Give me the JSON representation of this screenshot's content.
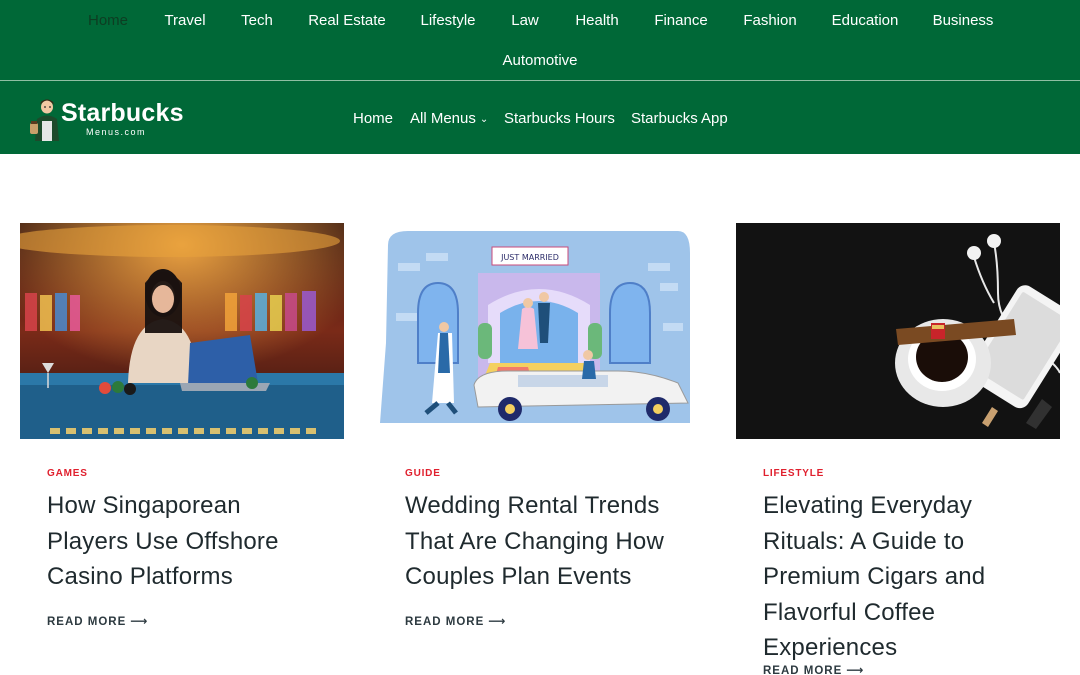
{
  "topnav": {
    "items": [
      "Home",
      "Travel",
      "Tech",
      "Real Estate",
      "Lifestyle",
      "Law",
      "Health",
      "Finance",
      "Fashion",
      "Education",
      "Business",
      "Automotive"
    ]
  },
  "header": {
    "logo_title": "Starbucks",
    "logo_sub": "Menus.com",
    "nav": {
      "home": "Home",
      "all_menus": "All Menus",
      "hours": "Starbucks Hours",
      "app": "Starbucks App"
    }
  },
  "posts": [
    {
      "category": "GAMES",
      "title": "How Singaporean Players Use Offshore Casino Platforms",
      "read_more": "READ MORE",
      "image": "casino-woman-laptop-image"
    },
    {
      "category": "GUIDE",
      "title": "Wedding Rental Trends That Are Changing How Couples Plan Events",
      "read_more": "READ MORE",
      "image": "wedding-limousine-illustration",
      "banner": "JUST MARRIED"
    },
    {
      "category": "LIFESTYLE",
      "title": "Elevating Everyday Rituals: A Guide to Premium Cigars and Flavorful Coffee Experiences",
      "read_more": "READ MORE",
      "image": "coffee-cigar-phone-image"
    }
  ],
  "colors": {
    "brand_green": "#006837",
    "category_red": "#e0202e",
    "text_dark": "#1f2a2e"
  }
}
